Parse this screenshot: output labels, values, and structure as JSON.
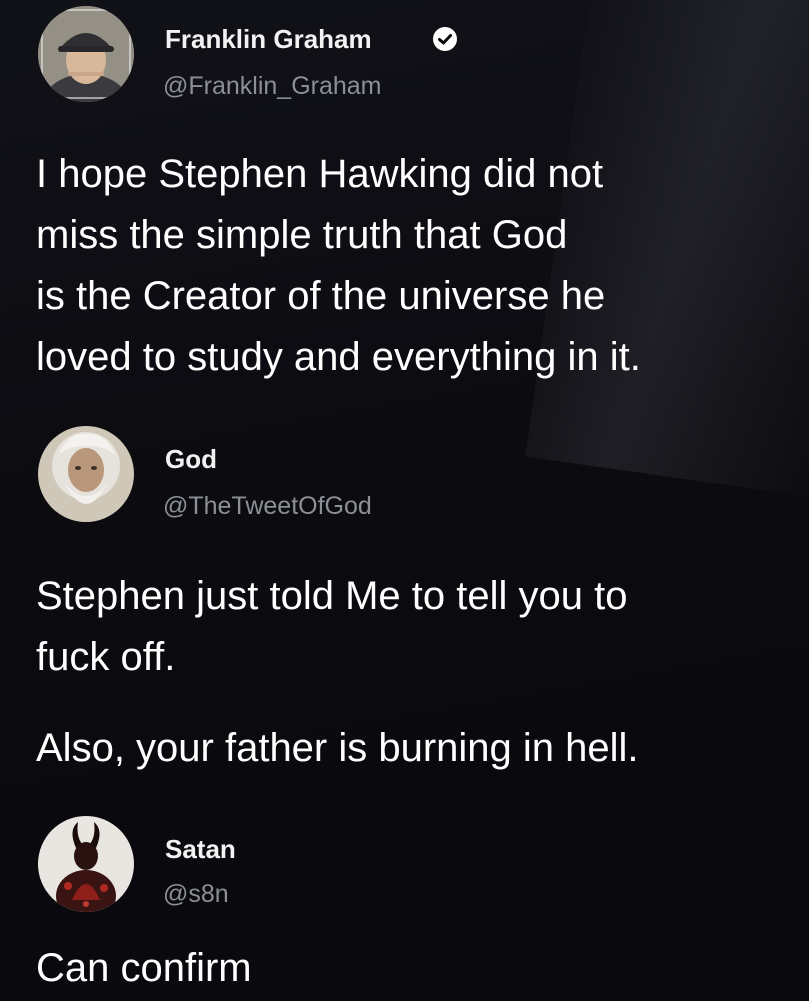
{
  "tweets": [
    {
      "name": "Franklin Graham",
      "handle": "@Franklin_Graham",
      "verified": true,
      "avatar_icon": "person-in-cap-avatar",
      "text_lines": [
        "I hope Stephen Hawking did not",
        "miss the simple truth that God",
        "is the Creator of the universe he",
        "loved to study and everything in it."
      ]
    },
    {
      "name": "God",
      "handle": "@TheTweetOfGod",
      "verified": false,
      "avatar_icon": "bearded-old-man-avatar",
      "paragraphs": [
        "Stephen just told Me to tell you to",
        "fuck off.",
        "Also, your father is burning in hell."
      ]
    },
    {
      "name": "Satan",
      "handle": "@s8n",
      "verified": false,
      "avatar_icon": "horned-devil-avatar",
      "text_lines": [
        "Can confirm"
      ]
    }
  ],
  "colors": {
    "background": "#0a0a0f",
    "text": "#ffffff",
    "handle": "#8b8f96",
    "verified": "#1d9bf0"
  }
}
